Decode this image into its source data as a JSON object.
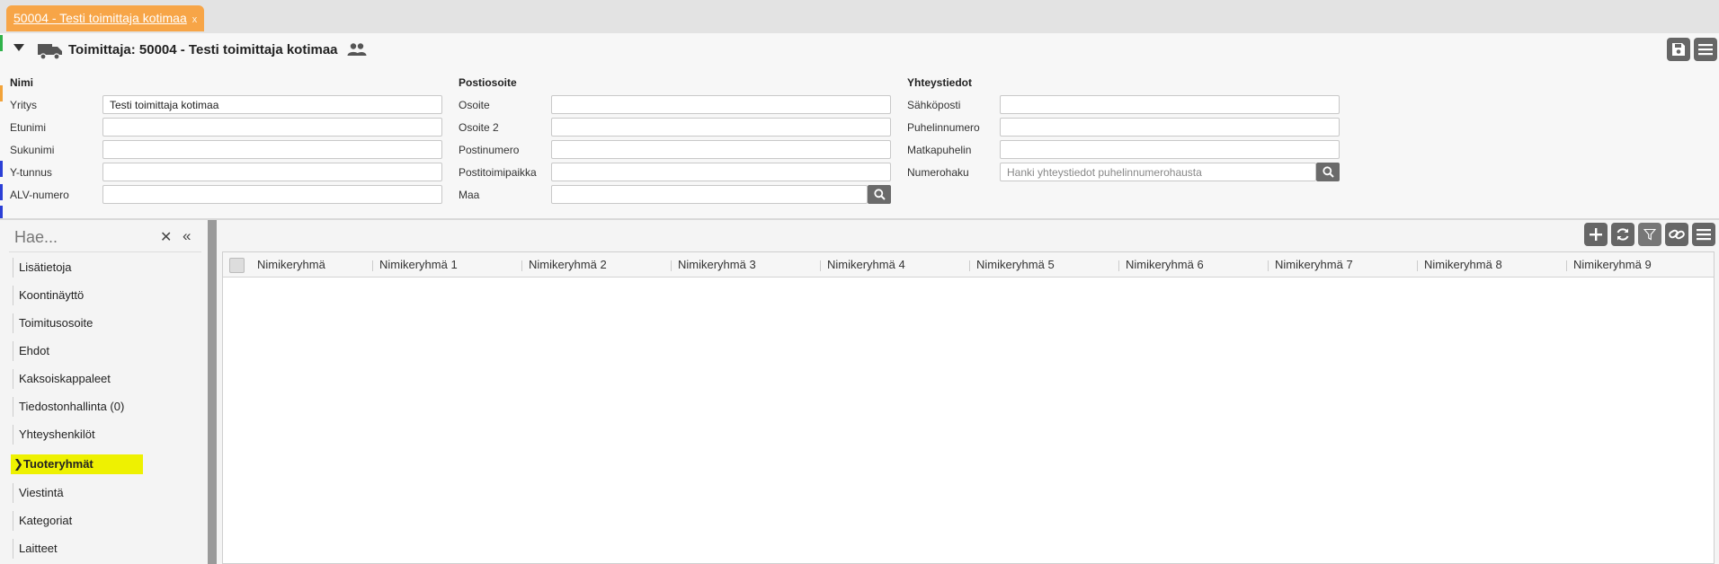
{
  "tab": {
    "title": "50004 - Testi toimittaja kotimaa",
    "close": "x"
  },
  "header": {
    "title": "Toimittaja: 50004 - Testi toimittaja kotimaa"
  },
  "colors": {
    "tab": "#f7a547",
    "active_item": "#eef101",
    "button": "#666666"
  },
  "icons": [
    "collapse-caret-icon",
    "truck-icon",
    "people-icon",
    "save-icon",
    "menu-icon",
    "search-icon",
    "close-icon",
    "double-chevron-left-icon",
    "chevron-right-icon",
    "plus-icon",
    "refresh-icon",
    "filter-icon",
    "link-icon"
  ],
  "form": {
    "nimi": {
      "title": "Nimi",
      "yritys_label": "Yritys",
      "yritys_value": "Testi toimittaja kotimaa",
      "etunimi_label": "Etunimi",
      "sukunimi_label": "Sukunimi",
      "ytunnus_label": "Y-tunnus",
      "alv_label": "ALV-numero"
    },
    "posti": {
      "title": "Postiosoite",
      "osoite_label": "Osoite",
      "osoite2_label": "Osoite 2",
      "postinumero_label": "Postinumero",
      "postitoimipaikka_label": "Postitoimipaikka",
      "maa_label": "Maa"
    },
    "yhteys": {
      "title": "Yhteystiedot",
      "sahkoposti_label": "Sähköposti",
      "puhelin_label": "Puhelinnumero",
      "matkapuhelin_label": "Matkapuhelin",
      "numerohaku_label": "Numerohaku",
      "numerohaku_placeholder": "Hanki yhteystiedot puhelinnumerohausta"
    }
  },
  "sidebar": {
    "search_placeholder": "Hae...",
    "items": [
      "Lisätietoja",
      "Koontinäyttö",
      "Toimitusosoite",
      "Ehdot",
      "Kaksoiskappaleet",
      "Tiedostonhallinta (0)",
      "Yhteyshenkilöt",
      "Tuoteryhmät",
      "Viestintä",
      "Kategoriat",
      "Laitteet"
    ],
    "active": "Tuoteryhmät"
  },
  "grid": {
    "columns": [
      "Nimikeryhmä",
      "Nimikeryhmä 1",
      "Nimikeryhmä 2",
      "Nimikeryhmä 3",
      "Nimikeryhmä 4",
      "Nimikeryhmä 5",
      "Nimikeryhmä 6",
      "Nimikeryhmä 7",
      "Nimikeryhmä 8",
      "Nimikeryhmä 9"
    ]
  }
}
